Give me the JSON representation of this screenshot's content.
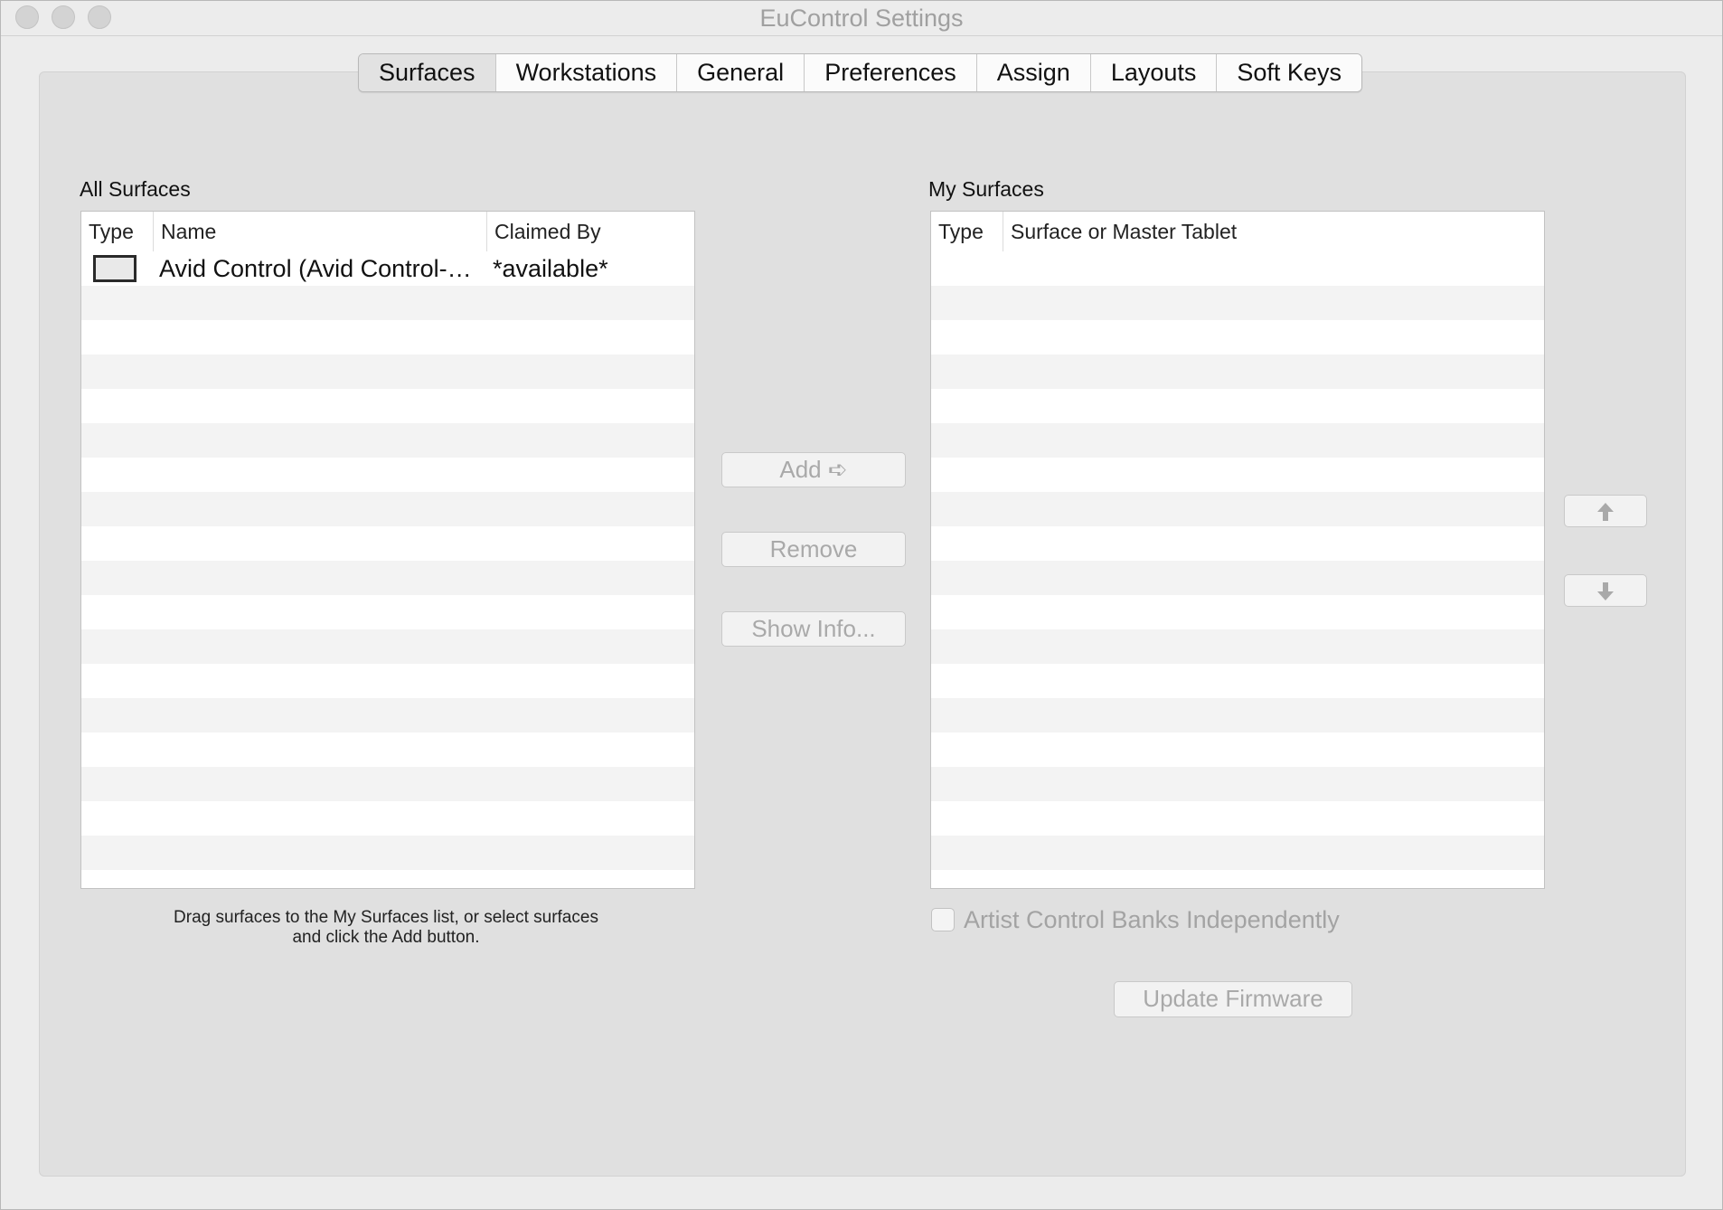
{
  "window": {
    "title": "EuControl Settings"
  },
  "tabs": [
    {
      "label": "Surfaces",
      "selected": true
    },
    {
      "label": "Workstations",
      "selected": false
    },
    {
      "label": "General",
      "selected": false
    },
    {
      "label": "Preferences",
      "selected": false
    },
    {
      "label": "Assign",
      "selected": false
    },
    {
      "label": "Layouts",
      "selected": false
    },
    {
      "label": "Soft Keys",
      "selected": false
    }
  ],
  "all_surfaces": {
    "label": "All Surfaces",
    "columns": [
      "Type",
      "Name",
      "Claimed By"
    ],
    "rows": [
      {
        "type_icon": "surface-icon",
        "name": "Avid Control (Avid Control-…",
        "claimed_by": "*available*"
      }
    ],
    "hint_line1": "Drag surfaces to the My Surfaces list, or select surfaces",
    "hint_line2": "and click the Add button."
  },
  "my_surfaces": {
    "label": "My Surfaces",
    "columns": [
      "Type",
      "Surface or Master Tablet"
    ],
    "rows": []
  },
  "buttons": {
    "add": "Add ➪",
    "remove": "Remove",
    "show_info": "Show Info...",
    "move_up_icon": "arrow-up-icon",
    "move_down_icon": "arrow-down-icon",
    "update_firmware": "Update Firmware"
  },
  "options": {
    "artist_banks_label": "Artist Control Banks Independently",
    "artist_banks_checked": false
  }
}
